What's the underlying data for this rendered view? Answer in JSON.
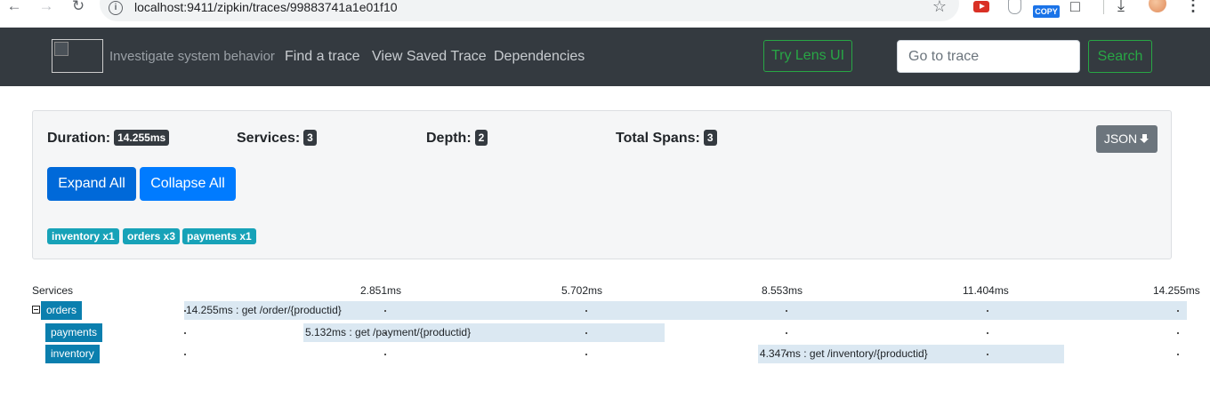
{
  "browser": {
    "url": "localhost:9411/zipkin/traces/99883741a1e01f10",
    "copy_ext_label": "COPY"
  },
  "navbar": {
    "tagline": "Investigate system behavior",
    "links": [
      "Find a trace",
      "View Saved Trace",
      "Dependencies"
    ],
    "lens_button": "Try Lens UI",
    "trace_input_placeholder": "Go to trace",
    "search_button": "Search"
  },
  "summary": {
    "duration_label": "Duration:",
    "duration_value": "14.255ms",
    "services_label": "Services:",
    "services_value": "3",
    "depth_label": "Depth:",
    "depth_value": "2",
    "total_spans_label": "Total Spans:",
    "total_spans_value": "3",
    "json_button": "JSON",
    "expand_all": "Expand All",
    "collapse_all": "Collapse All",
    "service_badges": [
      "inventory x1",
      "orders x3",
      "payments x1"
    ]
  },
  "timeline": {
    "services_header": "Services",
    "ticks": [
      "2.851ms",
      "5.702ms",
      "8.553ms",
      "11.404ms",
      "14.255ms"
    ],
    "total_duration_ms": 14.255,
    "rows": [
      {
        "service": "orders",
        "label": "14.255ms : get /order/{productid}",
        "start_ms": 0,
        "duration_ms": 14.255
      },
      {
        "service": "payments",
        "label": "5.132ms : get /payment/{productid}",
        "start_ms": 1.695,
        "duration_ms": 5.132
      },
      {
        "service": "inventory",
        "label": "4.347ms : get /inventory/{productid}",
        "start_ms": 8.157,
        "duration_ms": 4.347
      }
    ]
  },
  "colors": {
    "navbar_bg": "#343a40",
    "success": "#28a745",
    "primary": "#007bff",
    "service_badge": "#17a2b8",
    "service_name_bg": "#0b7fae",
    "span_bar": "#dbe8f2"
  }
}
